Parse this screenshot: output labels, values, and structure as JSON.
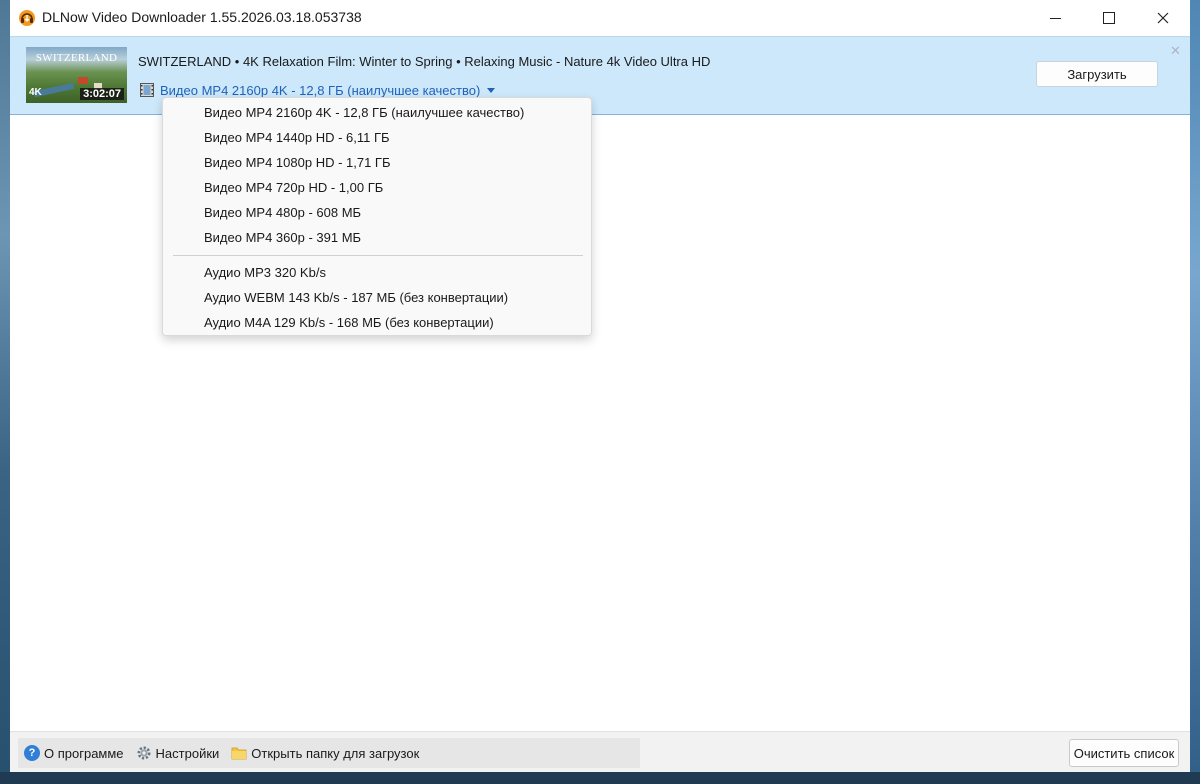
{
  "window": {
    "title": "DLNow Video Downloader 1.55.2026.03.18.053738",
    "minimize_icon": "minimize-icon",
    "maximize_icon": "maximize-icon",
    "close_icon": "close-icon"
  },
  "download_item": {
    "thumbnail": {
      "title_text": "SWITZERLAND",
      "badge": "4K",
      "duration": "3:02:07"
    },
    "title": "SWITZERLAND • 4K Relaxation Film: Winter to Spring • Relaxing Music - Nature 4k Video Ultra HD",
    "selected_format": "Видео MP4 2160p 4K - 12,8 ГБ (наилучшее качество)",
    "download_label": "Загрузить",
    "dismiss_glyph": "✕"
  },
  "format_menu": {
    "video_options": [
      "Видео MP4 2160p 4K - 12,8 ГБ (наилучшее качество)",
      "Видео MP4 1440p HD - 6,11 ГБ",
      "Видео MP4 1080p HD - 1,71 ГБ",
      "Видео MP4 720p HD - 1,00 ГБ",
      "Видео MP4 480p - 608 МБ",
      "Видео MP4 360p - 391 МБ"
    ],
    "audio_options": [
      "Аудио MP3 320 Kb/s",
      "Аудио WEBM 143 Kb/s - 187 МБ (без конвертации)",
      "Аудио M4A 129 Kb/s - 168 МБ (без конвертации)"
    ]
  },
  "bottom_bar": {
    "about_label": "О программе",
    "settings_label": "Настройки",
    "open_folder_label": "Открыть папку для загрузок",
    "clear_list_label": "Очистить список"
  },
  "colors": {
    "item_background": "#cde8fb",
    "link_blue": "#1f63b8",
    "help_icon_blue": "#2f7fd6"
  }
}
